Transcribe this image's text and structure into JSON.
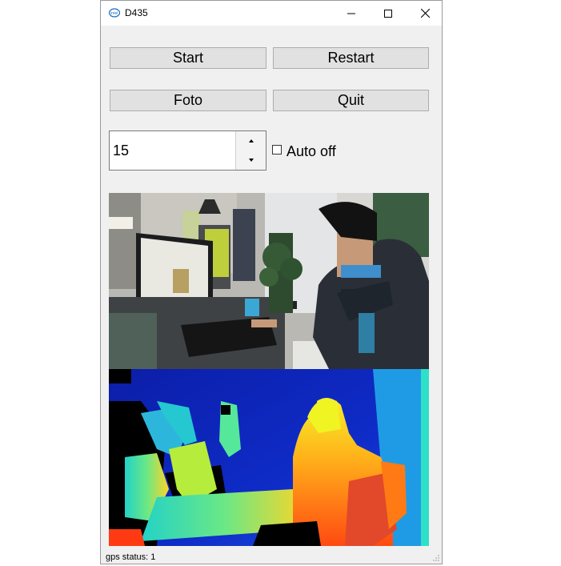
{
  "window": {
    "title": "D435",
    "icon": "intel-icon"
  },
  "titlebar_controls": {
    "minimize": "minimize-icon",
    "maximize": "maximize-icon",
    "close": "close-icon"
  },
  "buttons": {
    "start": "Start",
    "restart": "Restart",
    "foto": "Foto",
    "quit": "Quit"
  },
  "spinbox": {
    "value": "15",
    "up": "chevron-up-icon",
    "down": "chevron-down-icon"
  },
  "auto_off": {
    "label": "Auto off",
    "checked": false
  },
  "images": {
    "color_stream": "rgb-camera-frame",
    "depth_stream": "depth-colormap-frame"
  },
  "statusbar": {
    "text": "gps status: 1"
  },
  "colors": {
    "window_bg": "#f0f0f0",
    "button_bg": "#e1e1e1",
    "button_border": "#adadad"
  }
}
